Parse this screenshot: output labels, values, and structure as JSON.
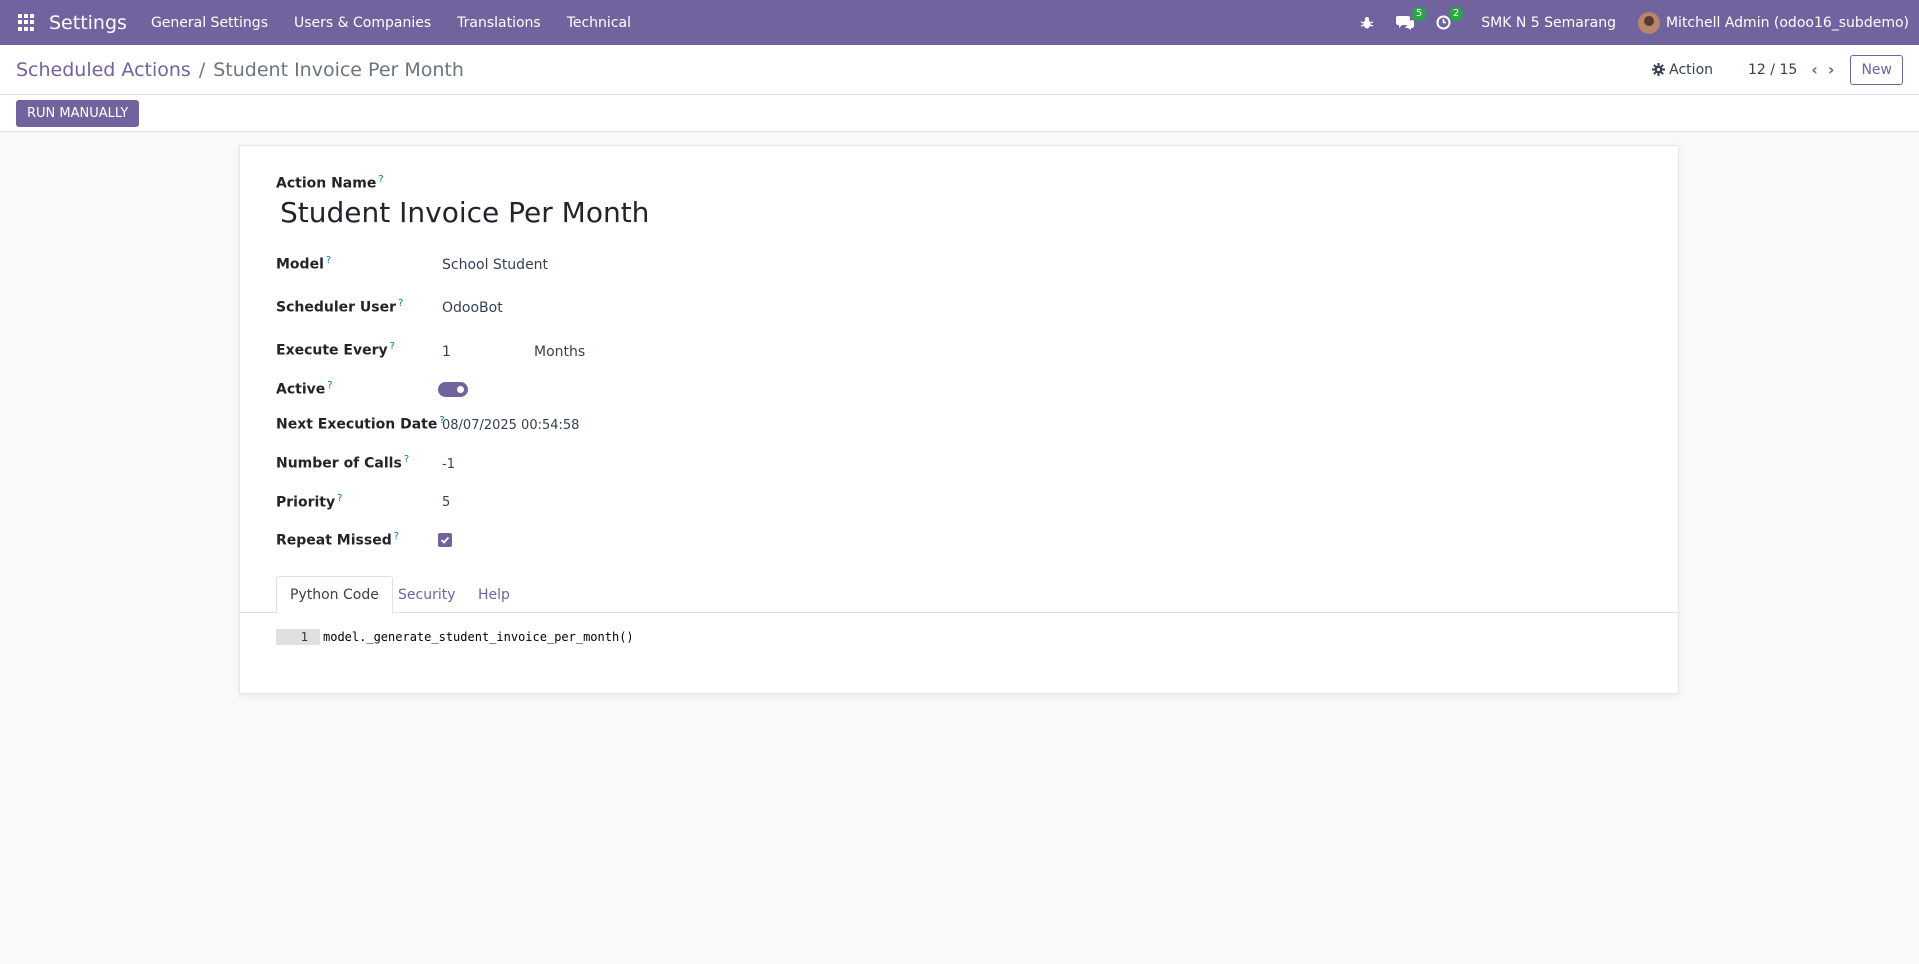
{
  "navbar": {
    "app_name": "Settings",
    "menu": [
      "General Settings",
      "Users & Companies",
      "Translations",
      "Technical"
    ],
    "messages_badge": "5",
    "activities_badge": "2",
    "company": "SMK N 5 Semarang",
    "user": "Mitchell Admin (odoo16_subdemo)"
  },
  "control_panel": {
    "breadcrumb_parent": "Scheduled Actions",
    "breadcrumb_separator": "/",
    "breadcrumb_current": "Student Invoice Per Month",
    "action_label": "Action",
    "pager": "12 / 15",
    "new_label": "New"
  },
  "statusbar": {
    "run_manually_label": "RUN MANUALLY"
  },
  "form": {
    "help_mark": "?",
    "action_name_label": "Action Name",
    "action_name": "Student Invoice Per Month",
    "model_label": "Model",
    "model": "School Student",
    "scheduler_user_label": "Scheduler User",
    "scheduler_user": "OdooBot",
    "execute_every_label": "Execute Every",
    "interval_number": "1",
    "interval_type": "Months",
    "active_label": "Active",
    "active": true,
    "next_execution_label": "Next Execution Date",
    "next_execution": "08/07/2025 00:54:58",
    "number_of_calls_label": "Number of Calls",
    "number_of_calls": "-1",
    "priority_label": "Priority",
    "priority": "5",
    "repeat_missed_label": "Repeat Missed",
    "repeat_missed": true
  },
  "tabs": [
    {
      "label": "Python Code",
      "active": true
    },
    {
      "label": "Security",
      "active": false
    },
    {
      "label": "Help",
      "active": false
    }
  ],
  "code": {
    "line_number": "1",
    "line": "model._generate_student_invoice_per_month()"
  },
  "colors": {
    "brand": "#71639e",
    "badge": "#28a745",
    "help": "#017e84"
  }
}
